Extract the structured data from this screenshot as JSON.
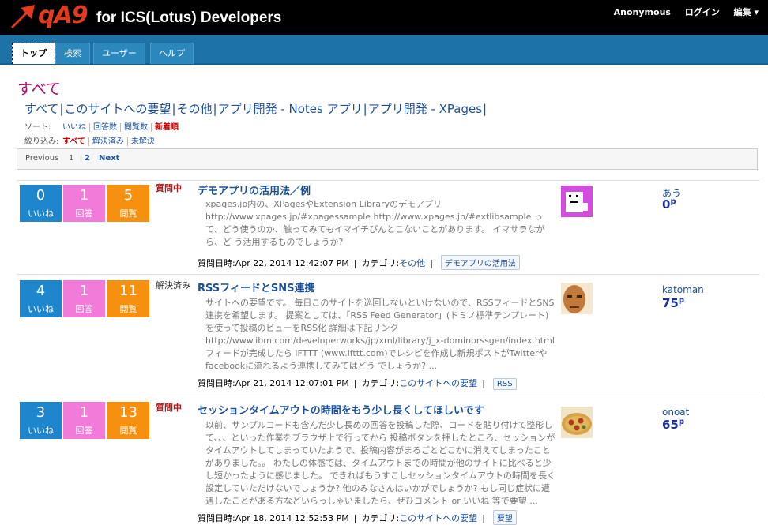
{
  "site": {
    "logo": "qA9",
    "subtitle": "for ICS(Lotus) Developers",
    "top_links": [
      "Anonymous",
      "ログイン",
      "編集 ▾"
    ]
  },
  "nav": {
    "tabs": [
      "トップ",
      "検索",
      "ユーザー",
      "ヘルプ"
    ],
    "active": "トップ"
  },
  "page_title": "すべて",
  "categories": [
    "すべて",
    "このサイトへの要望",
    "その他",
    "アプリ開発 - Notes アプリ",
    "アプリ開発 - XPages"
  ],
  "sort": {
    "label": "ソート:",
    "options": [
      "いいね",
      "回答数",
      "閲覧数",
      "新着順"
    ],
    "selected": "新着順"
  },
  "filter": {
    "label": "絞り込み:",
    "options": [
      "すべて",
      "解決済み",
      "未解決"
    ],
    "selected": "すべて"
  },
  "pager": {
    "previous": "Previous",
    "pages": [
      "1",
      "2"
    ],
    "next": "Next"
  },
  "stat_labels": {
    "like": "いいね",
    "answers": "回答",
    "views": "閲覧"
  },
  "meta_label": "質問日時:",
  "category_label": "カテゴリ:",
  "questions": [
    {
      "likes": "0",
      "answers": "1",
      "views": "5",
      "state": "質問中",
      "title": "デモアプリの活用法／例",
      "body": "xpages.jp内の、XPagesやExtension Libraryのデモアプリ http://www.xpages.jp/#xpagessample http://www.xpages.jp/#extlibsample って、どう使うのか、触ってみてもイマイチぴんとこないことがあります。 イマサラながら、ど う活用するものでしょうか?",
      "date": "Apr 22, 2014 12:42:07 PM",
      "category": "その他",
      "tag": "デモアプリの活用法",
      "user": "あう",
      "points": "0",
      "avatar": "pixel-cat"
    },
    {
      "likes": "4",
      "answers": "1",
      "views": "11",
      "state": "解決済み",
      "title": "RSSフィードとSNS連携",
      "body": "サイトへの要望です。 毎日このサイトを巡回しないといけないので、RSSフィードとSNS連携を希望します。 提案としては、「RSS Feed Generator」(ドミノ標準テンプレート)を使って投稿のビューをRSS化 詳細は下記リンク http://www.ibm.com/developerworks/jp/xml/library/j_x-dominorssgen/index.html フィードが完成したら IFTTT (www.ifttt.com)でレシピを作成し新規ポストがTwitterや facebookに流れるよう連携してみてはどう でしょうか? ...",
      "date": "Apr 21, 2014 12:07:01 PM",
      "category": "このサイトへの要望",
      "tag": "RSS",
      "user": "katoman",
      "points": "75",
      "avatar": "face"
    },
    {
      "likes": "3",
      "answers": "1",
      "views": "13",
      "state": "質問中",
      "title": "セッションタイムアウトの時間をもう少し長くしてほしいです",
      "body": "以前、サンプルコードも含んだ少し長めの回答を投稿した際、コードを貼り付けて整形して、、、といった作業をブラウザ上で行ってから 投稿ボタンを押したところ、セッションがタイムアウトしてしまっていたようで、投稿内容がまるごとどこかに消えてしまったことがありました。。 わたしの体感では、タイムアウトまでの時間が他のサイトに比べると少し短かったように感じました。 できればもうすこしセッションタイムアウトの時間を長く設定していただけないでしょうか? 他のみなさんはいかがでしょうか? もし同じ症状に遭遇したことがある方などいらっしゃいましたら、ぜひコメント or いいね 等で要望 ...",
      "date": "Apr 18, 2014 12:52:53 PM",
      "category": "このサイトへの要望",
      "tag": "要望",
      "user": "onoat",
      "points": "65",
      "avatar": "pizza"
    }
  ],
  "colors": {
    "topbar": "#000000",
    "nav": "#1e73a6",
    "like": "#1d86cc",
    "answers": "#f27ad8",
    "views": "#f7900f",
    "title_pink": "#c0006c"
  }
}
